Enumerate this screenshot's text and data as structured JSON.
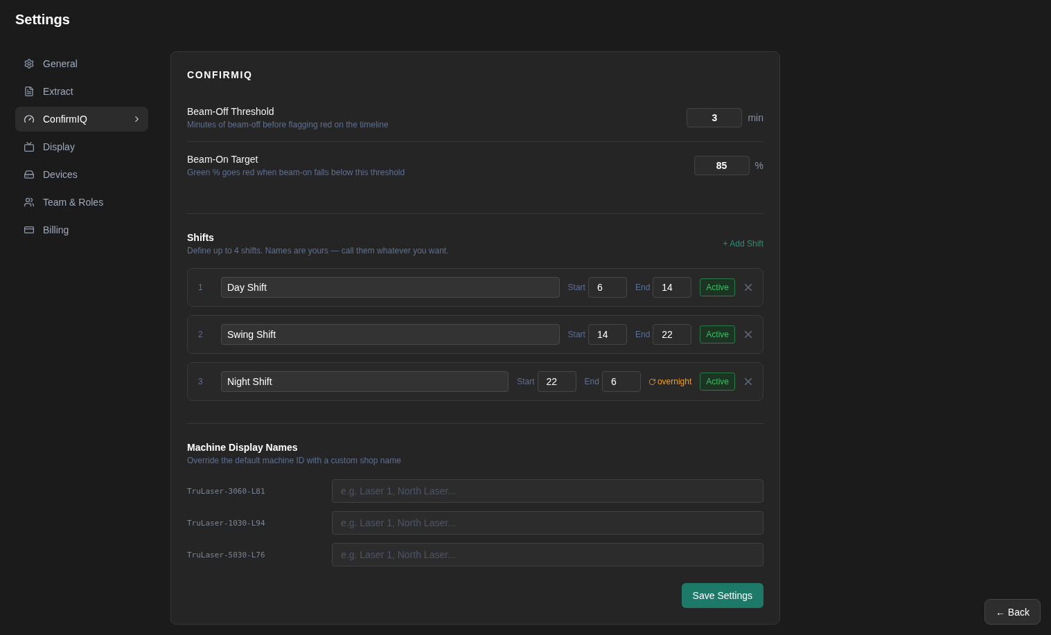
{
  "page": {
    "title": "Settings"
  },
  "sidebar": {
    "items": [
      {
        "label": "General",
        "selected": false
      },
      {
        "label": "Extract",
        "selected": false
      },
      {
        "label": "ConfirmIQ",
        "selected": true
      },
      {
        "label": "Display",
        "selected": false
      },
      {
        "label": "Devices",
        "selected": false
      },
      {
        "label": "Team & Roles",
        "selected": false
      },
      {
        "label": "Billing",
        "selected": false
      }
    ]
  },
  "panel": {
    "heading": "CONFIRMIQ",
    "settings": [
      {
        "label": "Beam-Off Threshold",
        "description": "Minutes of beam-off before flagging red on the timeline",
        "value": "3",
        "unit": "min"
      },
      {
        "label": "Beam-On Target",
        "description": "Green % goes red when beam-on falls below this threshold",
        "value": "85",
        "unit": "%"
      }
    ],
    "shifts": {
      "title": "Shifts",
      "description": "Define up to 4 shifts. Names are yours — call them whatever you want.",
      "add_button": "+ Add Shift",
      "rows": [
        {
          "number": "1",
          "name": "Day Shift",
          "start_label": "Start",
          "start": "6",
          "end_label": "End",
          "end": "14",
          "active_label": "Active",
          "active": true
        },
        {
          "number": "2",
          "name": "Swing Shift",
          "start_label": "Start",
          "start": "14",
          "end_label": "End",
          "end": "22",
          "active_label": "Active",
          "active": true
        },
        {
          "number": "3",
          "name": "Night Shift",
          "start_label": "Start",
          "start": "22",
          "end_label": "End",
          "end": "6",
          "note": "overnight",
          "active_label": "Active",
          "active": true
        }
      ]
    },
    "machine_names": {
      "title": "Machine Display Names",
      "description": "Override the default machine ID with a custom shop name",
      "rows": [
        {
          "machine": "TruLaser-3060-L81",
          "placeholder": "e.g. Laser 1, North Laser..."
        },
        {
          "machine": "TruLaser-1030-L94",
          "placeholder": "e.g. Laser 1, North Laser..."
        },
        {
          "machine": "TruLaser-5030-L76",
          "placeholder": "e.g. Laser 1, North Laser..."
        }
      ]
    },
    "save_button": "Save Settings"
  },
  "back_button": "← Back"
}
